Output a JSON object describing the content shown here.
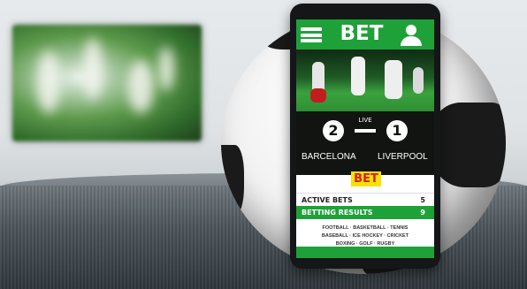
{
  "app": {
    "title": "BET",
    "menu_icon": "hamburger-menu-icon",
    "user_icon": "user-icon",
    "accent_color": "#1fa13a",
    "cta_color": "#f5e400"
  },
  "match": {
    "home_score": "2",
    "away_score": "1",
    "status": "LIVE",
    "home_team": "BARCELONA",
    "away_team": "LIVERPOOL"
  },
  "bet_button_label": "BET",
  "bets": {
    "active_label": "ACTIVE BETS",
    "active_count": "5",
    "results_label": "BETTING RESULTS",
    "results_count": "9"
  },
  "sports_list": {
    "line1": "FOOTBALL · BASKETBALL · TENNIS",
    "line2": "BASEBALL · ICE HOCKEY · CRICKET",
    "line3": "BOXING · GOLF · RUGBY"
  }
}
